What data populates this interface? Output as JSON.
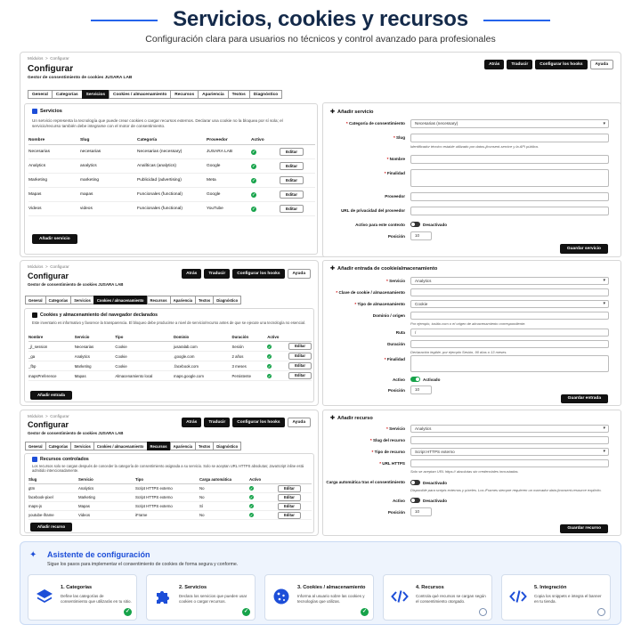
{
  "hero": {
    "title": "Servicios, cookies y recursos",
    "subtitle": "Configuración clara para usuarios no técnicos y control avanzado para profesionales"
  },
  "admin": {
    "crumb_modules": "Módulos",
    "crumb_sep": ">",
    "crumb_config": "Configurar",
    "title": "Configurar",
    "subtitle": "Gestor de consentimiento de cookies JUSARA LAB",
    "buttons": {
      "back": "Atrás",
      "translate": "Traducir",
      "hooks": "Configurar los hooks",
      "help": "Ayuda"
    },
    "tabs": [
      "General",
      "Categorías",
      "Servicios",
      "Cookies / almacenamiento",
      "Recursos",
      "Apariencia",
      "Textos",
      "Diagnóstico"
    ]
  },
  "services": {
    "heading": "Servicios",
    "description": "Un servicio representa la tecnología que puede crear cookies o cargar recursos externos. Declarar una cookie no la bloquea por sí sola; el servicio/recurso también debe integrarse con el motor de consentimiento.",
    "columns": [
      "Nombre",
      "Slug",
      "Categoría",
      "Proveedor",
      "Activo",
      ""
    ],
    "rows": [
      {
        "name": "Necesarias",
        "slug": "necesarias",
        "category": "Necesarias (necessary)",
        "provider": "JUSARA LAB",
        "action": "Editar"
      },
      {
        "name": "Analytics",
        "slug": "analytics",
        "category": "Analíticas (analytics)",
        "provider": "Google",
        "action": "Editar"
      },
      {
        "name": "Marketing",
        "slug": "marketing",
        "category": "Publicidad (advertising)",
        "provider": "Meta",
        "action": "Editar"
      },
      {
        "name": "Mapas",
        "slug": "mapas",
        "category": "Funcionales (functional)",
        "provider": "Google",
        "action": "Editar"
      },
      {
        "name": "Videos",
        "slug": "videos",
        "category": "Funcionales (functional)",
        "provider": "YouTube",
        "action": "Editar"
      }
    ],
    "add_button": "Añadir servicio"
  },
  "add_service": {
    "heading": "Añadir servicio",
    "category_label": "Categoría de consentimiento",
    "category_value": "Necesarias (necessary)",
    "slug_label": "Slug",
    "slug_hint": "Identificador técnico estable utilizado por datos-jlconsent-service y la API pública.",
    "name_label": "Nombre",
    "purpose_label": "Finalidad",
    "provider_label": "Proveedor",
    "privacy_label": "URL de privacidad del proveedor",
    "active_label": "Activo para este contexto",
    "active_value": "Desactivado",
    "position_label": "Posición",
    "position_value": "10",
    "save_button": "Guardar servicio"
  },
  "cookies": {
    "heading": "Cookies y almacenamiento del navegador declarados",
    "description": "Este inventario es informativo y favorece la transparencia. El bloqueo debe producirse a nivel de servicio/recurso antes de que se ejecute una tecnología no esencial.",
    "columns": [
      "Nombre",
      "Servicio",
      "Tipo",
      "Dominio",
      "Duración",
      "Activo",
      ""
    ],
    "rows": [
      {
        "name": "_jl_session",
        "service": "Necesarias",
        "type": "Cookie",
        "domain": "jusaralab.com",
        "duration": "Sesión",
        "action": "Editar"
      },
      {
        "name": "_ga",
        "service": "Analytics",
        "type": "Cookie",
        "domain": ".google.com",
        "duration": "2 años",
        "action": "Editar"
      },
      {
        "name": "_fbp",
        "service": "Marketing",
        "type": "Cookie",
        "domain": ".facebook.com",
        "duration": "3 meses",
        "action": "Editar"
      },
      {
        "name": "mapsPreference",
        "service": "Mapas",
        "type": "Almacenamiento local",
        "domain": "maps.google.com",
        "duration": "Persistente",
        "action": "Editar"
      }
    ],
    "add_button": "Añadir entrada"
  },
  "add_cookie": {
    "heading": "Añadir entrada de cookie/almacenamiento",
    "service_label": "Servicio",
    "service_value": "Analytics",
    "key_label": "Clave de cookie / almacenamiento",
    "storage_label": "Tipo de almacenamiento",
    "storage_value": "Cookie",
    "domain_label": "Dominio / origen",
    "domain_hint": "Por ejemplo, tusitio.com o el origen de almacenamiento correspondiente.",
    "path_label": "Ruta",
    "path_value": "/",
    "duration_label": "Duración",
    "duration_hint": "Declaración legible, por ejemplo Sesión, 90 días o 13 meses.",
    "purpose_label": "Finalidad",
    "active_label": "Activo",
    "active_value": "Activado",
    "position_label": "Posición",
    "position_value": "10",
    "save_button": "Guardar entrada"
  },
  "resources": {
    "heading": "Recursos controlados",
    "description": "Los recursos solo se cargan después de conceder la categoría de consentimiento asignada a su servicio. Solo se aceptan URL HTTPS absolutas; JavaScript inline está admitido intencionadamente.",
    "columns": [
      "Slug",
      "Servicio",
      "Tipo",
      "Carga automática",
      "Activo",
      ""
    ],
    "rows": [
      {
        "slug": "gtm",
        "service": "Analytics",
        "type": "Script HTTPS externo",
        "auto": "No",
        "action": "Editar"
      },
      {
        "slug": "facebook-pixel",
        "service": "Marketing",
        "type": "Script HTTPS externo",
        "auto": "No",
        "action": "Editar"
      },
      {
        "slug": "maps-js",
        "service": "Mapas",
        "type": "Script HTTPS externo",
        "auto": "Sí",
        "action": "Editar"
      },
      {
        "slug": "youtube-iframe",
        "service": "Videos",
        "type": "iFrame",
        "auto": "No",
        "action": "Editar"
      }
    ],
    "add_button": "Añadir recurso"
  },
  "add_resource": {
    "heading": "Añadir recurso",
    "service_label": "Servicio",
    "service_value": "Analytics",
    "slug_label": "Slug del recurso",
    "type_label": "Tipo de recurso",
    "type_value": "Script HTTPS externo",
    "url_label": "URL HTTPS",
    "url_hint": "Solo se aceptan URL https:// absolutas sin credenciales incrustadas.",
    "auto_label": "Carga automática tras el consentimiento",
    "auto_value": "Desactivado",
    "auto_hint": "Disponible para scripts externos y píxeles. Los iFrames siempre requieren un marcador data-jlconsent-resource explícito.",
    "active_label": "Activo",
    "active_value": "Desactivado",
    "position_label": "Posición",
    "position_value": "10",
    "save_button": "Guardar recurso"
  },
  "wizard": {
    "title": "Asistente de configuración",
    "subtitle": "Sigue los pasos para implementar el consentimiento de cookies de forma segura y conforme.",
    "steps": [
      {
        "title": "1. Categorías",
        "desc": "Define las categorías de consentimiento que utilizarás en tu sitio.",
        "done": true,
        "icon": "layers-icon"
      },
      {
        "title": "2. Servicios",
        "desc": "Declara los servicios que pueden usar cookies o cargar recursos.",
        "done": true,
        "icon": "puzzle-icon"
      },
      {
        "title": "3. Cookies / almacenamiento",
        "desc": "Informa al usuario sobre las cookies y tecnologías que utilizas.",
        "done": true,
        "icon": "cookie-icon"
      },
      {
        "title": "4. Recursos",
        "desc": "Controla qué recursos se cargan según el consentimiento otorgado.",
        "done": false,
        "icon": "code-icon"
      },
      {
        "title": "5. Integración",
        "desc": "Copia los snippets e integra el banner en tu tienda.",
        "done": false,
        "icon": "code-icon"
      }
    ]
  },
  "colors": {
    "accent": "#1d4ed8",
    "success": "#16a34a",
    "dark": "#111111"
  }
}
